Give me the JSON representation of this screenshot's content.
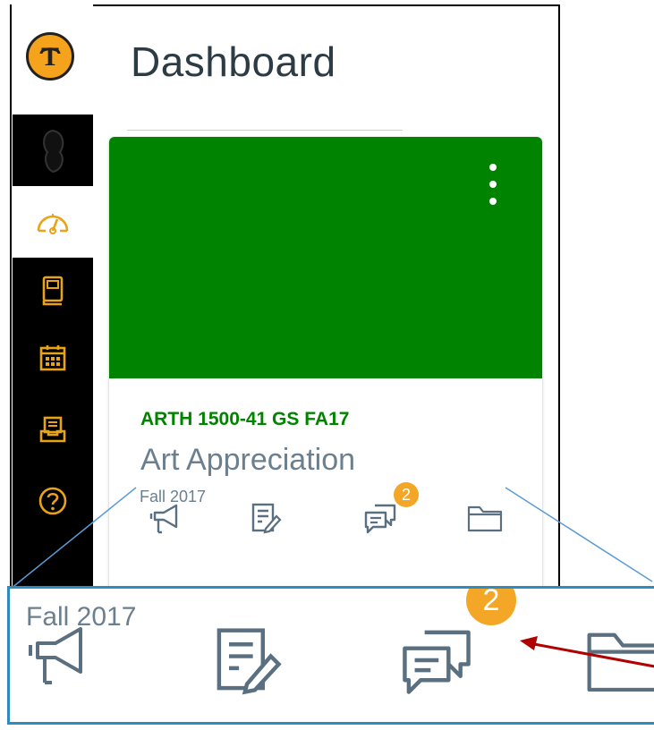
{
  "page": {
    "title": "Dashboard"
  },
  "nav": {
    "items": [
      {
        "name": "account",
        "icon": "avatar-icon"
      },
      {
        "name": "dashboard",
        "icon": "speedometer-icon"
      },
      {
        "name": "courses",
        "icon": "book-icon"
      },
      {
        "name": "calendar",
        "icon": "calendar-icon"
      },
      {
        "name": "inbox",
        "icon": "inbox-icon"
      },
      {
        "name": "help",
        "icon": "help-icon"
      }
    ]
  },
  "card": {
    "color": "#008400",
    "course_code": "ARTH 1500-41 GS FA17",
    "course_name": "Art Appreciation",
    "term": "Fall 2017",
    "discussions_badge": "2",
    "actions": [
      "announcements-icon",
      "assignments-icon",
      "discussions-icon",
      "files-icon"
    ]
  },
  "zoom": {
    "term": "Fall 2017",
    "discussions_badge": "2"
  },
  "colors": {
    "accent": "#f4a626",
    "nav_bg": "#000000",
    "callout": "#2e8bc0",
    "arrow": "#b00000"
  }
}
